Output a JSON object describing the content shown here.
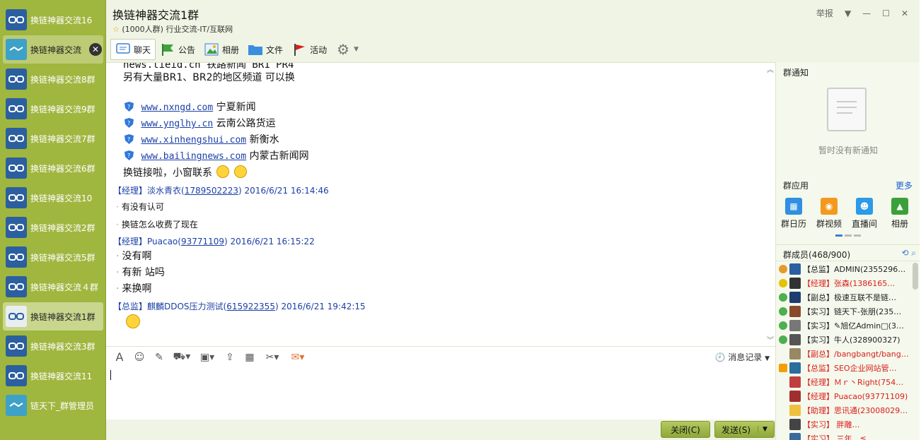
{
  "sidebar": {
    "items": [
      {
        "label": "换链神器交流16"
      },
      {
        "label": "换链神器交流"
      },
      {
        "label": "换链神器交流8群"
      },
      {
        "label": "换链神器交流9群"
      },
      {
        "label": "换链神器交流7群"
      },
      {
        "label": "换链神器交流6群"
      },
      {
        "label": "换链神器交流10"
      },
      {
        "label": "换链神器交流2群"
      },
      {
        "label": "换链神器交流5群"
      },
      {
        "label": "换链神器交流４群"
      },
      {
        "label": "换链神器交流1群"
      },
      {
        "label": "换链神器交流3群"
      },
      {
        "label": "换链神器交流11"
      },
      {
        "label": "链天下_群管理员"
      }
    ]
  },
  "header": {
    "title": "换链神器交流1群",
    "subtitle": "(1000人群) 行业交流-IT/互联网",
    "report": "举报"
  },
  "toolbar": {
    "chat": "聊天",
    "notice": "公告",
    "album": "相册",
    "file": "文件",
    "activity": "活动"
  },
  "chat": {
    "line_top": "news.tieid.cn  铁路新闻 BR1 PR4",
    "line_more": "另有大量BR1、BR2的地区频道  可以换",
    "links": [
      {
        "url": "www.nxngd.com",
        "name": "宁夏新闻"
      },
      {
        "url": "www.ynglhy.cn",
        "name": " 云南公路货运"
      },
      {
        "url": "www.xinhengshui.com",
        "name": "新衡水"
      },
      {
        "url": "www.bailingnews.com",
        "name": "内蒙古新闻网"
      }
    ],
    "closing": "换链接啦，小窗联系",
    "msg1_head_pre": "【经理】淡水青衣(",
    "msg1_uid": "1789502223",
    "msg1_head_post": ") 2016/6/21 16:14:46",
    "msg1_lines": [
      "有没有认可",
      "换链怎么收费了现在"
    ],
    "msg2_head_pre": "【经理】Puacao(",
    "msg2_uid": "93771109",
    "msg2_head_post": ") 2016/6/21 16:15:22",
    "msg2_lines": [
      "没有啊",
      "有新 站吗",
      "来换啊"
    ],
    "msg3_head_pre": "【总监】麒麟DDOS压力测试(",
    "msg3_uid": "615922355",
    "msg3_head_post": ") 2016/6/21 19:42:15"
  },
  "input": {
    "history": "消息记录",
    "close": "关闭(C)",
    "send": "发送(S)"
  },
  "right": {
    "notice_title": "群通知",
    "notice_empty": "暂时没有新通知",
    "apps_title": "群应用",
    "apps_more": "更多",
    "apps": [
      {
        "label": "群日历",
        "color": "#2f8fe0"
      },
      {
        "label": "群视频",
        "color": "#f39a1e"
      },
      {
        "label": "直播间",
        "color": "#2a9be8"
      },
      {
        "label": "相册",
        "color": "#3aa03a"
      }
    ],
    "members_title": "群成员(468/900)",
    "members": [
      {
        "text": "【总监】ADMIN(23552963…",
        "color": "#222"
      },
      {
        "text": "【经理】张森(1386165…",
        "color": "#d8201c"
      },
      {
        "text": "【副总】极速互联不是链…",
        "color": "#222"
      },
      {
        "text": "【实习】链天下-张朋(235…",
        "color": "#222"
      },
      {
        "text": "【实习】✎旭亿Admin□(3…",
        "color": "#222"
      },
      {
        "text": "【实习】牛人(328900327)",
        "color": "#222"
      },
      {
        "text": "【副总】/bangbangt/bang…",
        "color": "#d8201c"
      },
      {
        "text": "【总监】SEO企业网站管…",
        "color": "#d8201c"
      },
      {
        "text": "【经理】Ｍｒ丶Right(754…",
        "color": "#d8201c"
      },
      {
        "text": "【经理】Puacao(93771109)",
        "color": "#d8201c"
      },
      {
        "text": "【助理】思讯通(23008029…",
        "color": "#d8201c"
      },
      {
        "text": "【实习】                胖雕…",
        "color": "#d8201c"
      },
      {
        "text": "【实习】                三年、≦…",
        "color": "#d8201c"
      }
    ]
  }
}
